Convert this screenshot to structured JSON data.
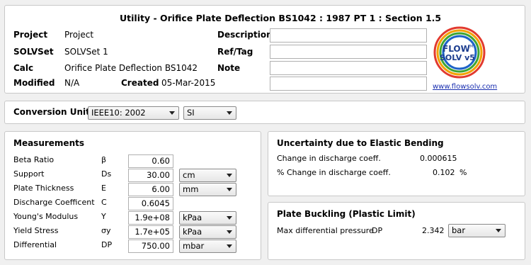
{
  "title": "Utility - Orifice Plate Deflection BS1042 : 1987 PT 1 : Section 1.5",
  "info": {
    "project_label": "Project",
    "project_value": "Project",
    "solvset_label": "SOLVSet",
    "solvset_value": "SOLVSet 1",
    "calc_label": "Calc",
    "calc_value": "Orifice Plate Deflection BS1042",
    "modified_label": "Modified",
    "modified_value": "N/A",
    "created_label": "Created",
    "created_value": "05-Mar-2015",
    "description_label": "Description",
    "description_value": "",
    "reftag_label": "Ref/Tag",
    "reftag_value": "",
    "note_label": "Note",
    "note_value": "",
    "extra_value": ""
  },
  "logo": {
    "line1": "FLOW",
    "tm": "TM",
    "line2": "SOLV v5",
    "url": "www.flowsolv.com"
  },
  "conversion": {
    "label": "Conversion Unit",
    "standard": "IEEE10: 2002",
    "system": "SI"
  },
  "measurements": {
    "title": "Measurements",
    "rows": [
      {
        "label": "Beta Ratio",
        "symbol": "β",
        "value": "0.60",
        "unit": ""
      },
      {
        "label": "Support",
        "symbol": "Ds",
        "value": "30.00",
        "unit": "cm"
      },
      {
        "label": "Plate Thickness",
        "symbol": "E",
        "value": "6.00",
        "unit": "mm"
      },
      {
        "label": "Discharge Coefficent",
        "symbol": "C",
        "value": "0.6045",
        "unit": ""
      },
      {
        "label": "Young's Modulus",
        "symbol": "Y",
        "value": "1.9e+08",
        "unit": "kPaa"
      },
      {
        "label": "Yield Stress",
        "symbol": "σy",
        "value": "1.7e+05",
        "unit": "kPaa"
      },
      {
        "label": "Differential",
        "symbol": "DP",
        "value": "750.00",
        "unit": "mbar"
      }
    ]
  },
  "uncertainty": {
    "title": "Uncertainty due to Elastic Bending",
    "row1_label": "Change in discharge coeff.",
    "row1_value": "0.000615",
    "row2_label": "% Change in discharge coeff.",
    "row2_value": "0.102",
    "row2_unit": "%"
  },
  "buckling": {
    "title": "Plate Buckling (Plastic Limit)",
    "label": "Max differential pressure",
    "symbol": "DP",
    "value": "2.342",
    "unit": "bar"
  }
}
